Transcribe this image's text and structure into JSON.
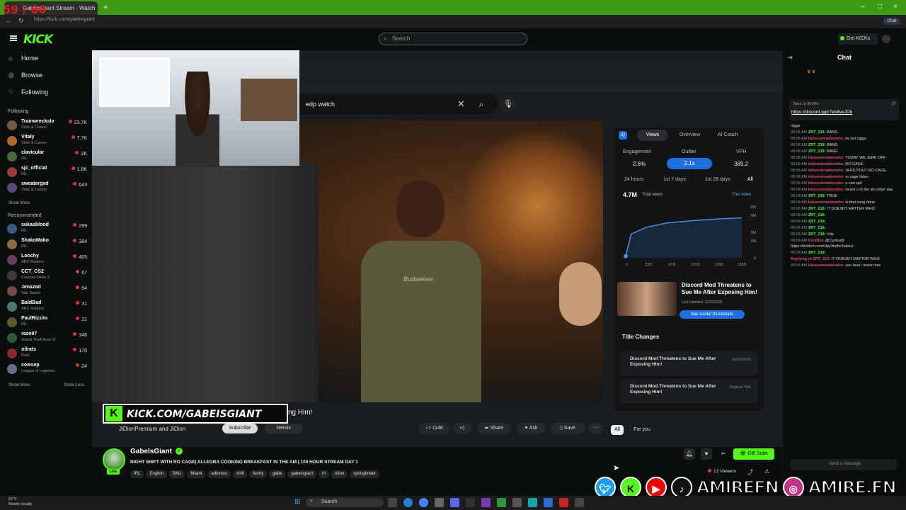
{
  "browser": {
    "fps": "59 / 60",
    "tab_title": "GabeIsGiant Stream - Watch",
    "url": "https://kick.com/gabeisgiant"
  },
  "header": {
    "logo": "KICK",
    "search_placeholder": "Search",
    "get_kicks": "Get KICKs"
  },
  "sidebar": {
    "nav": [
      {
        "label": "Home",
        "icon": "home-icon"
      },
      {
        "label": "Browse",
        "icon": "compass-icon"
      },
      {
        "label": "Following",
        "icon": "heart-icon"
      }
    ],
    "following_heading": "Following",
    "following": [
      {
        "name": "Trainwreckstv",
        "game": "Slots & Casino",
        "viewers": "23.7K",
        "color": "#7a5b3e"
      },
      {
        "name": "Vitaly",
        "game": "Slots & Casino",
        "viewers": "7.7K",
        "color": "#b26a2c"
      },
      {
        "name": "clavicular",
        "game": "IRL",
        "viewers": "2K",
        "color": "#4a6a3a"
      },
      {
        "name": "sjc_official",
        "game": "IRL",
        "viewers": "1.8K",
        "color": "#9a3a3a"
      },
      {
        "name": "sweatergxd",
        "game": "Slots & Casino",
        "viewers": "643",
        "color": "#5a4a7a"
      }
    ],
    "show_more_1": "Show More",
    "recommended_heading": "Recommended",
    "recommended": [
      {
        "name": "sukasblood",
        "game": "IRL",
        "viewers": "299",
        "color": "#3a5a8a"
      },
      {
        "name": "ShakoMako",
        "game": "IRL",
        "viewers": "384",
        "color": "#8a6a3a"
      },
      {
        "name": "Loochy",
        "game": "ARC Raiders",
        "viewers": "405",
        "color": "#6a3a5a"
      },
      {
        "name": "CCT_CS2",
        "game": "Counter-Strike 2",
        "viewers": "67",
        "color": "#3a3a3a"
      },
      {
        "name": "Jenazad",
        "game": "Star Savior",
        "viewers": "54",
        "color": "#7a4a4a"
      },
      {
        "name": "BaldBad",
        "game": "ARC Raiders",
        "viewers": "31",
        "color": "#4a7a6a"
      },
      {
        "name": "PaulRizzim",
        "game": "IRL",
        "viewers": "21",
        "color": "#5a5a2a"
      },
      {
        "name": "razo97",
        "game": "Grand Theft Auto IV",
        "viewers": "346",
        "color": "#2a5a3a"
      },
      {
        "name": "oilrats",
        "game": "Rust",
        "viewers": "170",
        "color": "#8a2a2a"
      },
      {
        "name": "cowsep",
        "game": "League of Legends",
        "viewers": "24",
        "color": "#6a6a8a"
      }
    ],
    "show_more_2": "Show More",
    "show_less": "Show Less"
  },
  "stream_overlay": {
    "yt_search_query": "edp watch",
    "vidiq": {
      "tabs": [
        "Views",
        "Overview",
        "AI Coach"
      ],
      "metrics_labels": [
        "Engagement",
        "Outlier",
        "VPH"
      ],
      "metrics_values": [
        "2.6%",
        "2.1x",
        "369.2"
      ],
      "ranges": [
        "24 hours",
        "1st 7 days",
        "1st 28 days",
        "All"
      ],
      "total_views": "4.7M",
      "total_views_label": "Total views",
      "this_video": "This video",
      "similar_title": "Discord Mod Threatens to Sue Me After Exposing Him!",
      "similar_date": "Last Updated: 10/16/2025",
      "similar_button": "See similar thumbnails",
      "title_changes_heading": "Title Changes",
      "title_changes": [
        {
          "title": "Discord Mod Threatens to Sue Me After Exposing Him!",
          "date": "10/16/2025"
        },
        {
          "title": "Discord Mod Threatens to Sue Me After Exposing Him!",
          "date": "Original Title"
        }
      ]
    },
    "video_shirt_text": "Budweiser",
    "banner_text": "KICK.COM/GABEISGIANT",
    "banner_tail": "ng Him!",
    "channel_line": "JiDionPremium and JiDion",
    "subscribe": "Subscribe",
    "remix": "Remix",
    "actions": [
      {
        "label": "114K",
        "icon": "thumbs-up-icon"
      },
      {
        "label": "",
        "icon": "thumbs-down-icon"
      },
      {
        "label": "Share",
        "icon": "share-icon"
      },
      {
        "label": "Ask",
        "icon": "sparkle-icon"
      },
      {
        "label": "Save",
        "icon": "bookmark-icon"
      }
    ],
    "chip_all": "All",
    "chip_for_you": "For you"
  },
  "chart_data": {
    "type": "line",
    "title": "",
    "x_ticks": [
      "0",
      "33D",
      "67D",
      "101D",
      "135D",
      "168D"
    ],
    "y_ticks": [
      "6M",
      "5M",
      "3M",
      "2M",
      "0"
    ],
    "series": [
      {
        "values": [
          0.2,
          2.8,
          3.6,
          4.1,
          4.4,
          4.6,
          4.7
        ]
      }
    ],
    "x": [
      0,
      8,
      30,
      60,
      100,
      140,
      168
    ],
    "ylim": [
      0,
      6
    ]
  },
  "stream_info": {
    "streamer": "GabeIsGiant",
    "live": "LIVE",
    "title": "NIGHT SHIFT WITH RO CAGE| ALLEGRA COOKING BREAKFAST IN THE AM | 100 HOUR STREAM DAY 1",
    "tags": [
      "IRL",
      "English",
      "BAU",
      "Miami",
      "adinross",
      "chill",
      "funny",
      "gabe",
      "gabeisgiant",
      "irl",
      "n3on",
      "springbreak"
    ],
    "gift_subs": "Gift Subs",
    "viewers": "13 Viewers"
  },
  "chat": {
    "title": "Chat",
    "pinned_link": "https://discord.gg/r7eb4veJDb",
    "pinned_by": "Sent by BotRix",
    "lines": [
      {
        "time": "",
        "user": "",
        "msg": "nigga"
      },
      {
        "time": "08:08 AM",
        "user": "ZRT_219:",
        "msg": "BANG"
      },
      {
        "time": "08:08 AM",
        "user": "itdoesntmatterwho:",
        "msg": "its not nigga"
      },
      {
        "time": "08:08 AM",
        "user": "ZRT_219:",
        "msg": "BANG"
      },
      {
        "time": "08:08 AM",
        "user": "ZRT_219:",
        "msg": "BANG"
      },
      {
        "time": "08:08 AM",
        "user": "itdoesntmatterwho:",
        "msg": "TODAY WE JERK OFF"
      },
      {
        "time": "08:08 AM",
        "user": "itdoesntmatterwho:",
        "msg": "RO CAGE"
      },
      {
        "time": "08:08 AM",
        "user": "itdoesntmatterwho:",
        "msg": "SHOUTOUT RO CAGE"
      },
      {
        "time": "08:08 AM",
        "user": "itdoesntmatterwho:",
        "msg": "ro cage listen"
      },
      {
        "time": "08:08 AM",
        "user": "itdoesntmatterwho:",
        "msg": "u can spit"
      },
      {
        "time": "08:09 AM",
        "user": "itdoesntmatterwho:",
        "msg": "heard u in the stu other day"
      },
      {
        "time": "08:09 AM",
        "user": "ZRT_219:",
        "msg": "TRUE"
      },
      {
        "time": "08:09 AM",
        "user": "itdoesntmatterwho:",
        "msg": "is that song done"
      },
      {
        "time": "08:09 AM",
        "user": "ZRT_219:",
        "msg": "IT DOESNT MATTER WHO"
      },
      {
        "time": "08:09 AM",
        "user": "ZRT_219:",
        "msg": ""
      },
      {
        "time": "08:09 AM",
        "user": "ZRT_219:",
        "msg": ""
      },
      {
        "time": "08:09 AM",
        "user": "ZRT_219:",
        "msg": ""
      },
      {
        "time": "08:09 AM",
        "user": "ZRT_219:",
        "msg": "!clip"
      },
      {
        "time": "08:09 AM",
        "user": "KickBot:",
        "msg": "@Cynical9 https://kickbot.com/clip/4kdhv3alxtcz"
      },
      {
        "time": "08:09 AM",
        "user": "ZRT_219:",
        "msg": ""
      },
      {
        "time": "",
        "user": "Replying to ZRT_219:",
        "msg": "IT DOESNT MATTER WHO"
      },
      {
        "time": "08:09 AM",
        "user": "itdoesntmatterwho:",
        "msg": "see how i move now"
      }
    ],
    "input_placeholder": "Send a message"
  },
  "social_overlay": {
    "handle_1": "AMIREFN",
    "handle_2": "AMIRE.FN"
  },
  "taskbar": {
    "weather_temp": "67°F",
    "weather_desc": "Mostly cloudy",
    "search": "Search"
  }
}
